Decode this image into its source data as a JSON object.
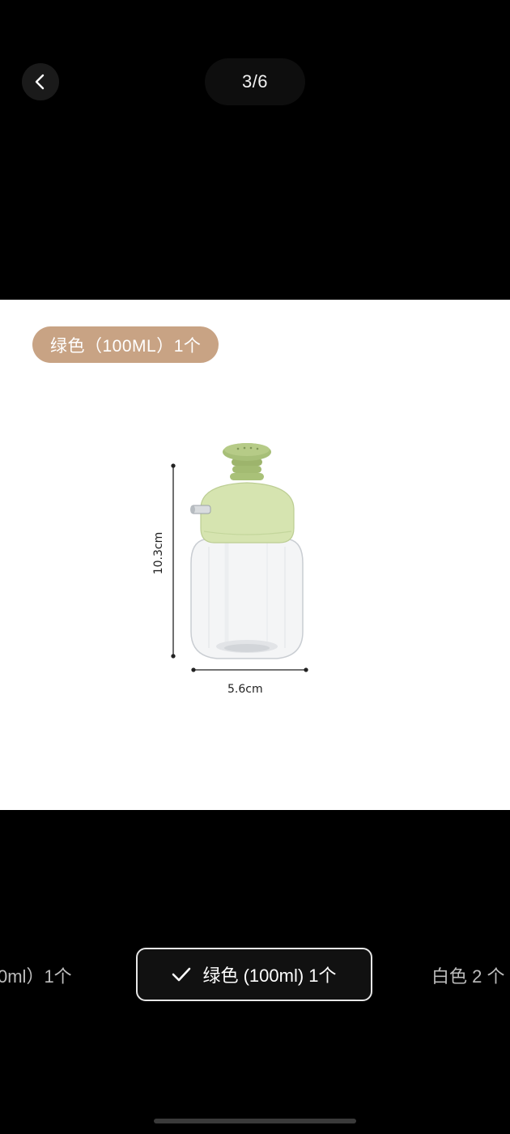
{
  "header": {
    "back_icon": "chevron-left-icon",
    "page_counter": "3/6"
  },
  "image": {
    "variant_tag": "绿色（100ML）1个",
    "height_label": "10.3cm",
    "width_label": "5.6cm",
    "lid_color": "#d8e6b4",
    "tag_color": "#c8a384"
  },
  "variants": {
    "left_partial": "0ml）1个",
    "selected": "绿色 (100ml) 1个",
    "right_partial": "白色 2 个"
  }
}
